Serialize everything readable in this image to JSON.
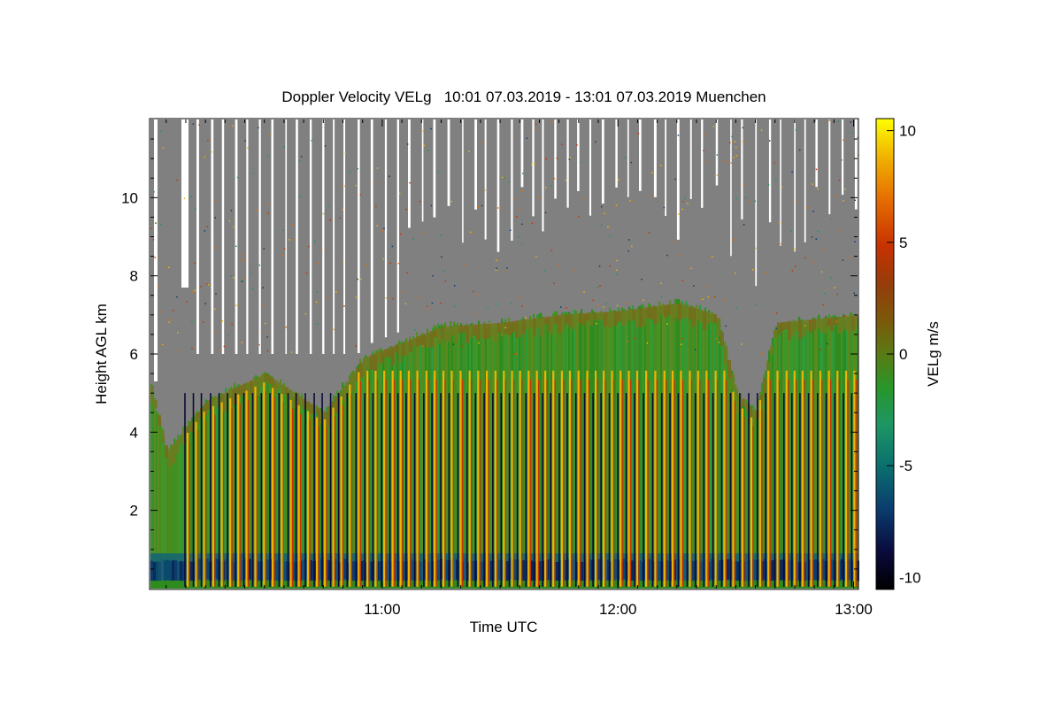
{
  "chart_data": {
    "type": "heatmap",
    "title": "Doppler Velocity VELg   10:01 07.03.2019 - 13:01 07.03.2019 Muenchen",
    "xlabel": "Time UTC",
    "ylabel": "Height AGL km",
    "x_range": [
      "10:01",
      "13:01"
    ],
    "x_ticks": [
      "11:00",
      "12:00",
      "13:00"
    ],
    "ylim": [
      0,
      12
    ],
    "y_ticks": [
      2,
      4,
      6,
      8,
      10
    ],
    "colorbar": {
      "label": "VELg m/s",
      "range": [
        -10.5,
        10.5
      ],
      "ticks": [
        10,
        5,
        0,
        -5,
        -10
      ],
      "colors": [
        "#000000",
        "#0a0a3c",
        "#0a3c6e",
        "#0a6e6e",
        "#1e9664",
        "#289628",
        "#3c8c1e",
        "#6e6e14",
        "#963c0a",
        "#c83200",
        "#e66e00",
        "#f0b400",
        "#ffff00"
      ]
    },
    "no_signal_color": "#808080",
    "cloud_top_km": [
      {
        "t": "10:01",
        "h": 5.2
      },
      {
        "t": "10:05",
        "h": 3.5
      },
      {
        "t": "10:15",
        "h": 4.8
      },
      {
        "t": "10:30",
        "h": 5.5
      },
      {
        "t": "10:45",
        "h": 4.5
      },
      {
        "t": "10:55",
        "h": 5.9
      },
      {
        "t": "11:05",
        "h": 6.3
      },
      {
        "t": "11:15",
        "h": 6.7
      },
      {
        "t": "11:30",
        "h": 6.8
      },
      {
        "t": "11:45",
        "h": 7.0
      },
      {
        "t": "12:00",
        "h": 7.1
      },
      {
        "t": "12:15",
        "h": 7.3
      },
      {
        "t": "12:25",
        "h": 7.0
      },
      {
        "t": "12:30",
        "h": 5.0
      },
      {
        "t": "12:35",
        "h": 4.5
      },
      {
        "t": "12:40",
        "h": 6.8
      },
      {
        "t": "13:01",
        "h": 7.0
      }
    ],
    "near_ground_layer_km": [
      0.2,
      0.9
    ]
  }
}
